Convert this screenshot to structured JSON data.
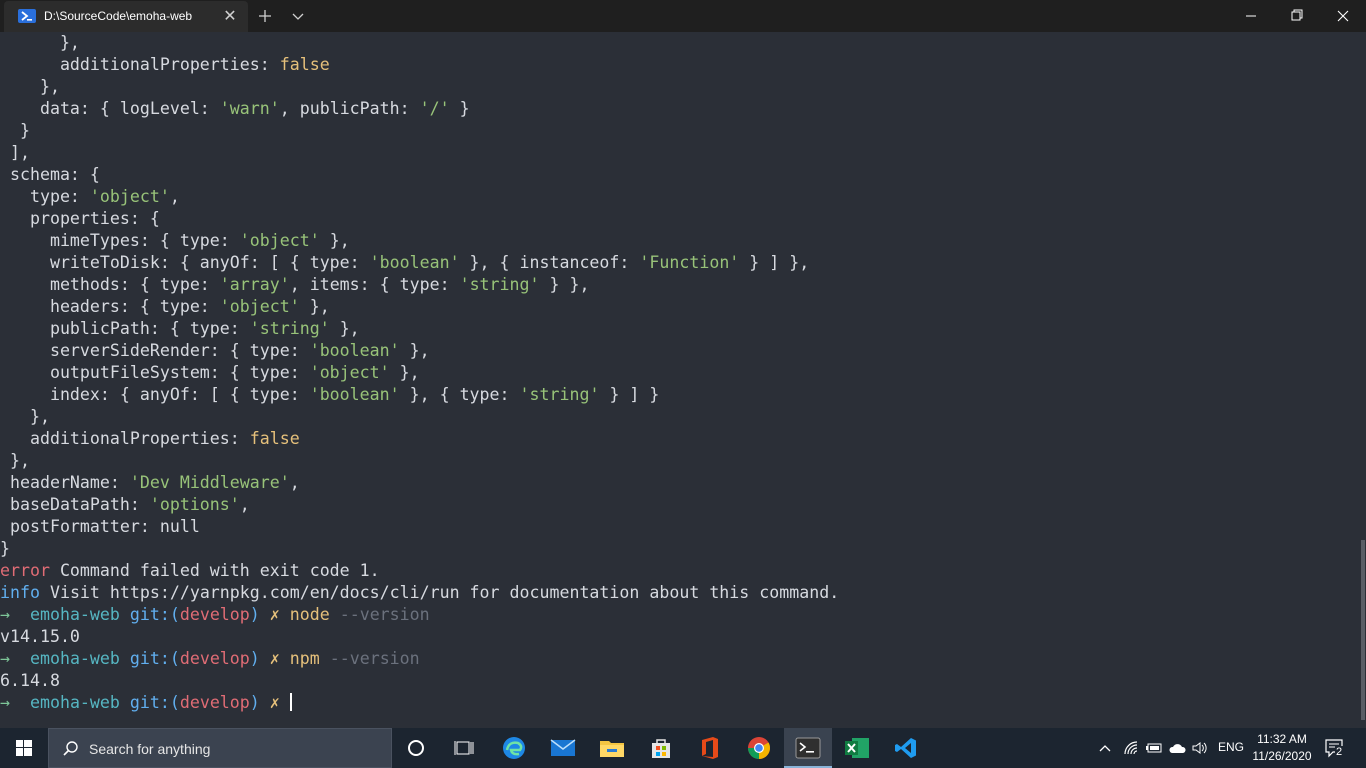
{
  "titlebar": {
    "tab_title": "D:\\SourceCode\\emoha-web",
    "tab_icon": "powershell-icon",
    "close_tab_glyph": "✕",
    "new_tab_icon": "plus-icon",
    "dropdown_icon": "chevron-down-icon",
    "window_controls": [
      "minimize-icon",
      "maximize-icon",
      "close-icon"
    ]
  },
  "terminal": {
    "lines": [
      [
        {
          "t": "      },",
          "c": "plain"
        }
      ],
      [
        {
          "t": "      additionalProperties: ",
          "c": "plain"
        },
        {
          "t": "false",
          "c": "kw"
        }
      ],
      [
        {
          "t": "    },",
          "c": "plain"
        }
      ],
      [
        {
          "t": "    data: { logLevel: ",
          "c": "plain"
        },
        {
          "t": "'warn'",
          "c": "str"
        },
        {
          "t": ", publicPath: ",
          "c": "plain"
        },
        {
          "t": "'/'",
          "c": "str"
        },
        {
          "t": " }",
          "c": "plain"
        }
      ],
      [
        {
          "t": "  }",
          "c": "plain"
        }
      ],
      [
        {
          "t": " ],",
          "c": "plain"
        }
      ],
      [
        {
          "t": " schema: {",
          "c": "plain"
        }
      ],
      [
        {
          "t": "   type: ",
          "c": "plain"
        },
        {
          "t": "'object'",
          "c": "str"
        },
        {
          "t": ",",
          "c": "plain"
        }
      ],
      [
        {
          "t": "   properties: {",
          "c": "plain"
        }
      ],
      [
        {
          "t": "     mimeTypes: { type: ",
          "c": "plain"
        },
        {
          "t": "'object'",
          "c": "str"
        },
        {
          "t": " },",
          "c": "plain"
        }
      ],
      [
        {
          "t": "     writeToDisk: { anyOf: [ { type: ",
          "c": "plain"
        },
        {
          "t": "'boolean'",
          "c": "str"
        },
        {
          "t": " }, { instanceof: ",
          "c": "plain"
        },
        {
          "t": "'Function'",
          "c": "str"
        },
        {
          "t": " } ] },",
          "c": "plain"
        }
      ],
      [
        {
          "t": "     methods: { type: ",
          "c": "plain"
        },
        {
          "t": "'array'",
          "c": "str"
        },
        {
          "t": ", items: { type: ",
          "c": "plain"
        },
        {
          "t": "'string'",
          "c": "str"
        },
        {
          "t": " } },",
          "c": "plain"
        }
      ],
      [
        {
          "t": "     headers: { type: ",
          "c": "plain"
        },
        {
          "t": "'object'",
          "c": "str"
        },
        {
          "t": " },",
          "c": "plain"
        }
      ],
      [
        {
          "t": "     publicPath: { type: ",
          "c": "plain"
        },
        {
          "t": "'string'",
          "c": "str"
        },
        {
          "t": " },",
          "c": "plain"
        }
      ],
      [
        {
          "t": "     serverSideRender: { type: ",
          "c": "plain"
        },
        {
          "t": "'boolean'",
          "c": "str"
        },
        {
          "t": " },",
          "c": "plain"
        }
      ],
      [
        {
          "t": "     outputFileSystem: { type: ",
          "c": "plain"
        },
        {
          "t": "'object'",
          "c": "str"
        },
        {
          "t": " },",
          "c": "plain"
        }
      ],
      [
        {
          "t": "     index: { anyOf: [ { type: ",
          "c": "plain"
        },
        {
          "t": "'boolean'",
          "c": "str"
        },
        {
          "t": " }, { type: ",
          "c": "plain"
        },
        {
          "t": "'string'",
          "c": "str"
        },
        {
          "t": " } ] }",
          "c": "plain"
        }
      ],
      [
        {
          "t": "   },",
          "c": "plain"
        }
      ],
      [
        {
          "t": "   additionalProperties: ",
          "c": "plain"
        },
        {
          "t": "false",
          "c": "kw"
        }
      ],
      [
        {
          "t": " },",
          "c": "plain"
        }
      ],
      [
        {
          "t": " headerName: ",
          "c": "plain"
        },
        {
          "t": "'Dev Middleware'",
          "c": "str"
        },
        {
          "t": ",",
          "c": "plain"
        }
      ],
      [
        {
          "t": " baseDataPath: ",
          "c": "plain"
        },
        {
          "t": "'options'",
          "c": "str"
        },
        {
          "t": ",",
          "c": "plain"
        }
      ],
      [
        {
          "t": " postFormatter: null",
          "c": "plain"
        }
      ],
      [
        {
          "t": "}",
          "c": "plain"
        }
      ],
      [
        {
          "t": "error",
          "c": "err"
        },
        {
          "t": " Command failed with exit code 1.",
          "c": "plain"
        }
      ],
      [
        {
          "t": "info",
          "c": "info"
        },
        {
          "t": " Visit https://yarnpkg.com/en/docs/cli/run for documentation about this command.",
          "c": "plain"
        }
      ],
      [
        {
          "t": "→",
          "c": "arrow"
        },
        {
          "t": "  emoha-web ",
          "c": "dir"
        },
        {
          "t": "git:(",
          "c": "git"
        },
        {
          "t": "develop",
          "c": "branch"
        },
        {
          "t": ")",
          "c": "git"
        },
        {
          "t": " ✗ ",
          "c": "dirty"
        },
        {
          "t": "node",
          "c": "cmd"
        },
        {
          "t": " --version",
          "c": "arg"
        }
      ],
      [
        {
          "t": "v14.15.0",
          "c": "plain"
        }
      ],
      [
        {
          "t": "→",
          "c": "arrow"
        },
        {
          "t": "  emoha-web ",
          "c": "dir"
        },
        {
          "t": "git:(",
          "c": "git"
        },
        {
          "t": "develop",
          "c": "branch"
        },
        {
          "t": ")",
          "c": "git"
        },
        {
          "t": " ✗ ",
          "c": "dirty"
        },
        {
          "t": "npm",
          "c": "cmd"
        },
        {
          "t": " --version",
          "c": "arg"
        }
      ],
      [
        {
          "t": "6.14.8",
          "c": "plain"
        }
      ],
      [
        {
          "t": "→",
          "c": "arrow"
        },
        {
          "t": "  emoha-web ",
          "c": "dir"
        },
        {
          "t": "git:(",
          "c": "git"
        },
        {
          "t": "develop",
          "c": "branch"
        },
        {
          "t": ")",
          "c": "git"
        },
        {
          "t": " ✗ ",
          "c": "dirty"
        },
        {
          "t": "",
          "c": "cursor"
        }
      ]
    ]
  },
  "taskbar": {
    "search_placeholder": "Search for anything",
    "apps": [
      "cortana-icon",
      "task-view-icon",
      "edge-icon",
      "mail-icon",
      "file-explorer-icon",
      "store-icon",
      "office-icon",
      "chrome-icon",
      "terminal-icon",
      "excel-icon",
      "vscode-icon"
    ],
    "active_app": "terminal-icon",
    "tray_icons": [
      "show-hidden-icons-chevron",
      "wifi-icon",
      "battery-icon",
      "onedrive-icon",
      "volume-icon"
    ],
    "language": "ENG",
    "time": "11:32 AM",
    "date": "11/26/2020",
    "notification_count": "2"
  }
}
